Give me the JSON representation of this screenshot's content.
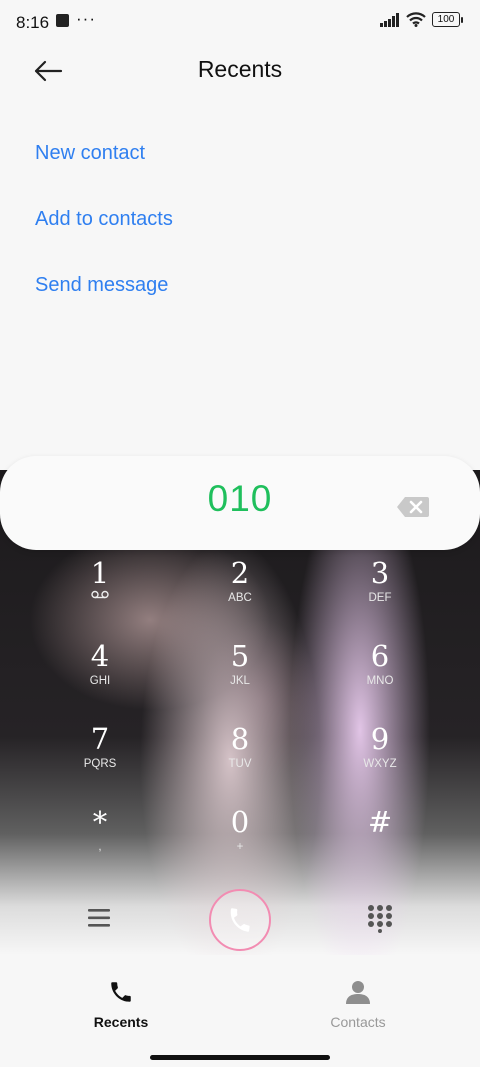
{
  "status_bar": {
    "time": "8:16",
    "dots": "···",
    "battery": "100"
  },
  "header": {
    "title": "Recents"
  },
  "actions": [
    {
      "label": "New contact"
    },
    {
      "label": "Add to contacts"
    },
    {
      "label": "Send message"
    }
  ],
  "dialer": {
    "number": "010",
    "accent_color": "#1fbf5c"
  },
  "keypad": [
    {
      "digit": "1",
      "sub": ""
    },
    {
      "digit": "2",
      "sub": "ABC"
    },
    {
      "digit": "3",
      "sub": "DEF"
    },
    {
      "digit": "4",
      "sub": "GHI"
    },
    {
      "digit": "5",
      "sub": "JKL"
    },
    {
      "digit": "6",
      "sub": "MNO"
    },
    {
      "digit": "7",
      "sub": "PQRS"
    },
    {
      "digit": "8",
      "sub": "TUV"
    },
    {
      "digit": "9",
      "sub": "WXYZ"
    },
    {
      "digit": "*",
      "sub": ","
    },
    {
      "digit": "0",
      "sub": "+"
    },
    {
      "digit": "#",
      "sub": ""
    }
  ],
  "bottom_nav": {
    "recents": "Recents",
    "contacts": "Contacts"
  },
  "icons": [
    "back-arrow-icon",
    "backspace-icon",
    "voicemail-icon",
    "menu-icon",
    "phone-icon",
    "dialpad-icon",
    "person-icon",
    "signal-icon",
    "wifi-icon",
    "battery-icon"
  ]
}
